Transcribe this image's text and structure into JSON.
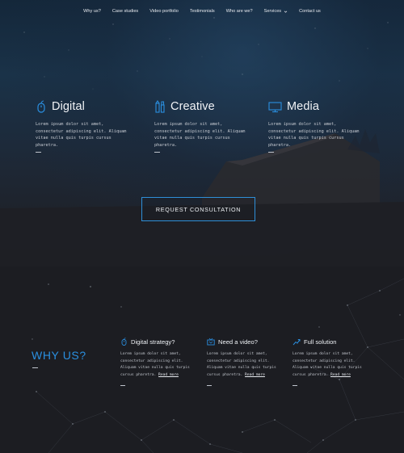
{
  "nav": {
    "items": [
      {
        "label": "Why us?"
      },
      {
        "label": "Case studies"
      },
      {
        "label": "Video portfolio"
      },
      {
        "label": "Testimonials"
      },
      {
        "label": "Who are we?"
      },
      {
        "label": "Services"
      },
      {
        "label": "Contact us"
      }
    ]
  },
  "hero": {
    "services": [
      {
        "title": "Digital",
        "icon": "mouse-icon",
        "text": "Lorem ipsum dolor sit amet, consectetur adipiscing elit. Aliquam vitae nulla quis turpis cursus pharetra."
      },
      {
        "title": "Creative",
        "icon": "pencil-brush-icon",
        "text": "Lorem ipsum dolor sit amet, consectetur adipiscing elit. Aliquam vitae nulla quis turpis cursus pharetra."
      },
      {
        "title": "Media",
        "icon": "monitor-icon",
        "text": "Lorem ipsum dolor sit amet, consectetur adipiscing elit. Aliquam vitae nulla quis turpis cursus pharetra."
      }
    ],
    "cta_label": "REQUEST CONSULTATION"
  },
  "why": {
    "title": "WHY US?",
    "features": [
      {
        "title": "Digital strategy?",
        "icon": "mouse-icon",
        "text": "Lorem ipsum dolor sit amet, consectetur adipiscing elit. Aliquam vitae nulla quis turpis cursus pharetra.",
        "link": "Read more"
      },
      {
        "title": "Need a video?",
        "icon": "tv-icon",
        "text": "Lorem ipsum dolor sit amet, consectetur adipiscing elit. Aliquam vitae nulla quis turpis cursus pharetra.",
        "link": "Read more"
      },
      {
        "title": "Full solution",
        "icon": "chart-growth-icon",
        "text": "Lorem ipsum dolor sit amet, consectetur adipiscing elit. Aliquam vitae nulla quis turpis cursus pharetra.",
        "link": "Read more"
      }
    ]
  },
  "colors": {
    "accent": "#2a8fe0",
    "background": "#1c1d22",
    "text": "#e8eaee"
  }
}
